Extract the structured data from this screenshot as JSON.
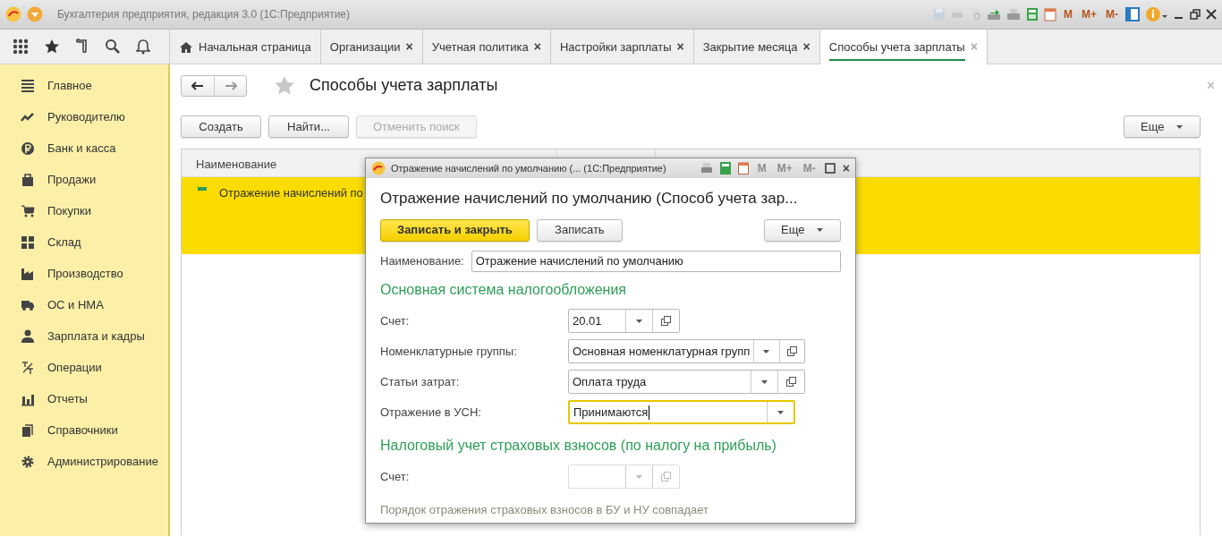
{
  "window": {
    "title": "Бухгалтерия предприятия, редакция 3.0  (1С:Предприятие)",
    "memory_buttons": [
      {
        "label": "M",
        "disabled": false
      },
      {
        "label": "M+",
        "disabled": false
      },
      {
        "label": "M-",
        "disabled": false
      }
    ]
  },
  "tabs": [
    {
      "label": "Начальная страница",
      "selected": false,
      "closable": false
    },
    {
      "label": "Организации",
      "selected": false,
      "closable": true
    },
    {
      "label": "Учетная политика",
      "selected": false,
      "closable": true
    },
    {
      "label": "Настройки зарплаты",
      "selected": false,
      "closable": true
    },
    {
      "label": "Закрытие месяца",
      "selected": false,
      "closable": true
    },
    {
      "label": "Способы учета зарплаты",
      "selected": true,
      "closable": true
    }
  ],
  "close_mark": "×",
  "sidebar": {
    "items": [
      {
        "label": "Главное"
      },
      {
        "label": "Руководителю"
      },
      {
        "label": "Банк и касса"
      },
      {
        "label": "Продажи"
      },
      {
        "label": "Покупки"
      },
      {
        "label": "Склад"
      },
      {
        "label": "Производство"
      },
      {
        "label": "ОС и НМА"
      },
      {
        "label": "Зарплата и кадры"
      },
      {
        "label": "Операции"
      },
      {
        "label": "Отчеты"
      },
      {
        "label": "Справочники"
      },
      {
        "label": "Администрирование"
      }
    ]
  },
  "page": {
    "title": "Способы учета зарплаты",
    "starred": false,
    "buttons": [
      {
        "label": "Создать",
        "disabled": false
      },
      {
        "label": "Найти...",
        "disabled": false
      },
      {
        "label": "Отменить поиск",
        "disabled": true
      }
    ],
    "more_button": "Еще",
    "close_mark": "×",
    "table": {
      "columns": [
        "Наименование"
      ],
      "rows": [
        {
          "name": "Отражение начислений по",
          "selected": true
        }
      ]
    }
  },
  "dialog": {
    "title": "Отражение начислений по умолчанию (...  (1С:Предприятие)",
    "memory_buttons": [
      {
        "label": "M",
        "disabled": true
      },
      {
        "label": "M+",
        "disabled": true
      },
      {
        "label": "M-",
        "disabled": true
      }
    ],
    "close_mark": "×",
    "heading": "Отражение начислений по умолчанию (Способ учета зар...",
    "buttons": [
      {
        "label": "Записать и закрыть",
        "kind": "primary"
      },
      {
        "label": "Записать",
        "kind": "default"
      }
    ],
    "more_button": "Еще",
    "name_field": {
      "label": "Наименование:",
      "value": "Отражение начислений по умолчанию"
    },
    "sections": [
      {
        "title": "Основная система налогообложения",
        "fields": [
          {
            "label": "Счет:",
            "value": "20.01",
            "kind": "account",
            "disabled": false,
            "focused": false
          },
          {
            "label": "Номенклатурные группы:",
            "value": "Основная номенклатурная групп",
            "kind": "reference",
            "disabled": false,
            "focused": false
          },
          {
            "label": "Статьи затрат:",
            "value": "Оплата труда",
            "kind": "reference",
            "disabled": false,
            "focused": false
          },
          {
            "label": "Отражение в УСН:",
            "value": "Принимаются",
            "kind": "choice",
            "disabled": false,
            "focused": true
          }
        ]
      },
      {
        "title": "Налоговый учет страховых взносов (по налогу на прибыль)",
        "fields": [
          {
            "label": "Счет:",
            "kind": "account",
            "disabled": true,
            "focused": false
          }
        ],
        "note": "Порядок отражения страховых взносов в БУ и НУ совпадает"
      }
    ]
  }
}
